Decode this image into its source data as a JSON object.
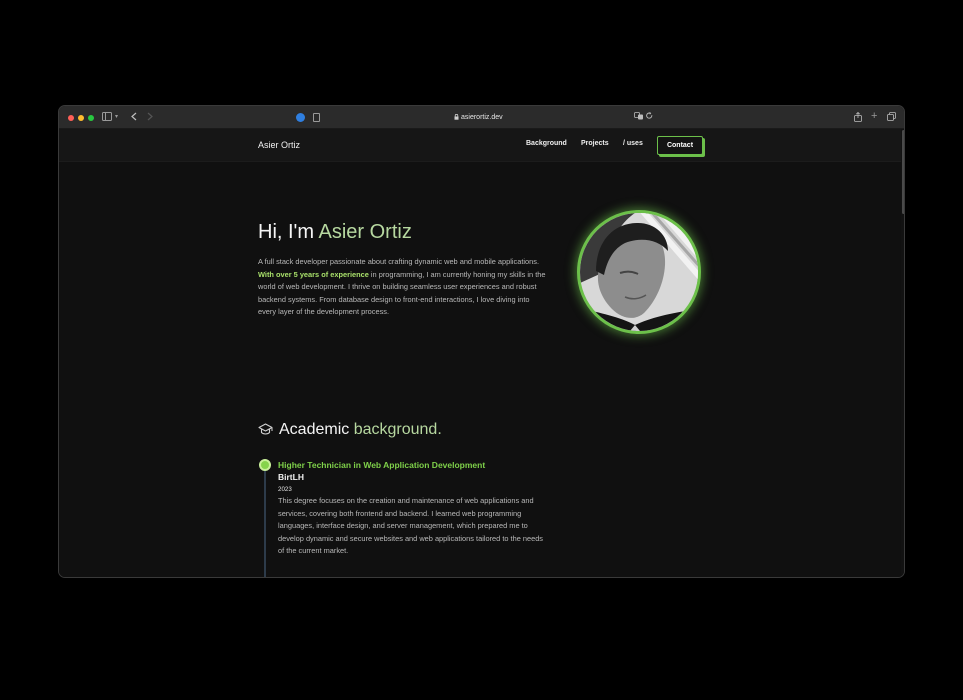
{
  "browser": {
    "url": "asierortiz.dev"
  },
  "nav": {
    "brand": "Asier Ortiz",
    "links": [
      "Background",
      "Projects",
      "/ uses"
    ],
    "contact": "Contact"
  },
  "hero": {
    "greeting": "Hi, I'm ",
    "name": "Asier Ortiz",
    "text_before": "A full stack developer passionate about crafting dynamic web and mobile applications. ",
    "highlight": "With over 5 years of experience",
    "text_after": " in programming, I am currently honing my skills in the world of web development. I thrive on building seamless user experiences and robust backend systems. From database design to front-end interactions, I love diving into every layer of the development process."
  },
  "academic": {
    "title_main": "Academic ",
    "title_accent": "background.",
    "items": [
      {
        "title": "Higher Technician in Web Application Development",
        "school": "BirtLH",
        "year": "2023",
        "description": "This degree focuses on the creation and maintenance of web applications and services, covering both frontend and backend. I learned web programming languages, interface design, and server management, which prepared me to develop dynamic and secure websites and web applications tailored to the needs of the current market."
      }
    ]
  },
  "colors": {
    "accent_green": "#6cc04a",
    "accent_soft": "#b7d8a0",
    "background": "#101010"
  },
  "icons": {
    "section": "graduation-cap-icon",
    "avatar": "profile-photo"
  }
}
